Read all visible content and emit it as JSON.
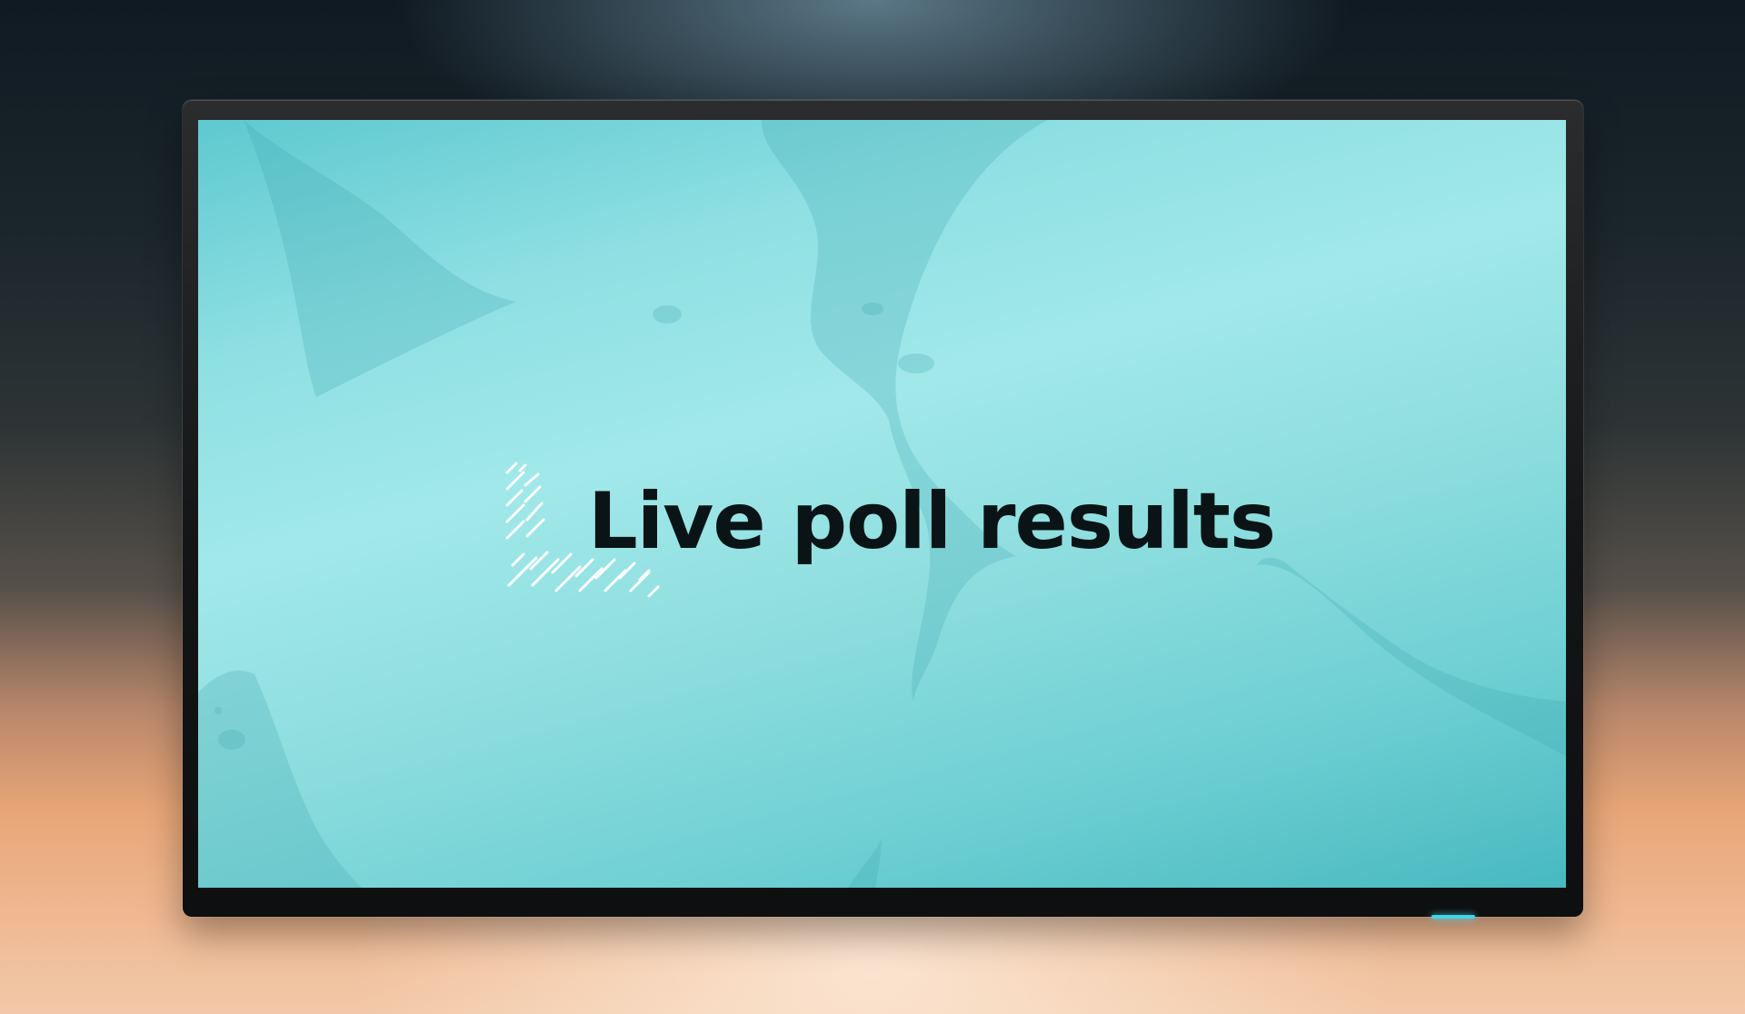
{
  "screen": {
    "title": "Live poll results"
  },
  "icons": {
    "decoration": "hatch-pattern-icon",
    "indicator": "power-led"
  },
  "colors": {
    "screen_accent": "#8fe0e3",
    "screen_shape": "#4fb3b8",
    "title_text": "#0a1416",
    "led": "#3fd6ea"
  }
}
